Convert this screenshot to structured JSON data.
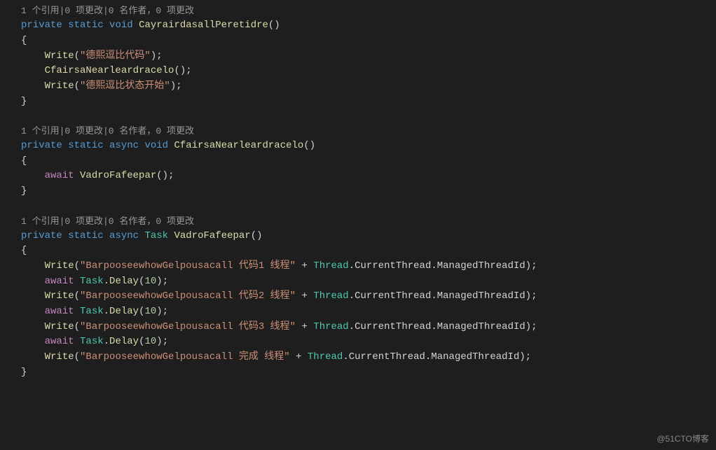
{
  "codelens": "1 个引用|0 项更改|0 名作者，0 项更改",
  "kw": {
    "private": "private",
    "static": "static",
    "void": "void",
    "async": "async",
    "await": "await"
  },
  "types": {
    "Task": "Task",
    "Thread": "Thread"
  },
  "methods": {
    "m1": "CayrairdasallPeretidre",
    "m2": "CfairsaNearleardracelo",
    "m3": "VadroFafeepar",
    "write": "Write",
    "delay": "Delay"
  },
  "props": {
    "currentThread": "CurrentThread",
    "managedThreadId": "ManagedThreadId"
  },
  "strings": {
    "s1": "\"德熙逗比代码\"",
    "s2": "\"德熙逗比状态开始\"",
    "s3": "\"BarpooseewhowGelpousacall 代码1 线程\"",
    "s4": "\"BarpooseewhowGelpousacall 代码2 线程\"",
    "s5": "\"BarpooseewhowGelpousacall 代码3 线程\"",
    "s6": "\"BarpooseewhowGelpousacall 完成 线程\""
  },
  "numbers": {
    "ten": "10"
  },
  "punct": {
    "openParen": "(",
    "closeParen": ")",
    "openBrace": "{",
    "closeBrace": "}",
    "semi": ";",
    "dot": ".",
    "plus": " + ",
    "empty": "()"
  },
  "watermark": "@51CTO博客"
}
